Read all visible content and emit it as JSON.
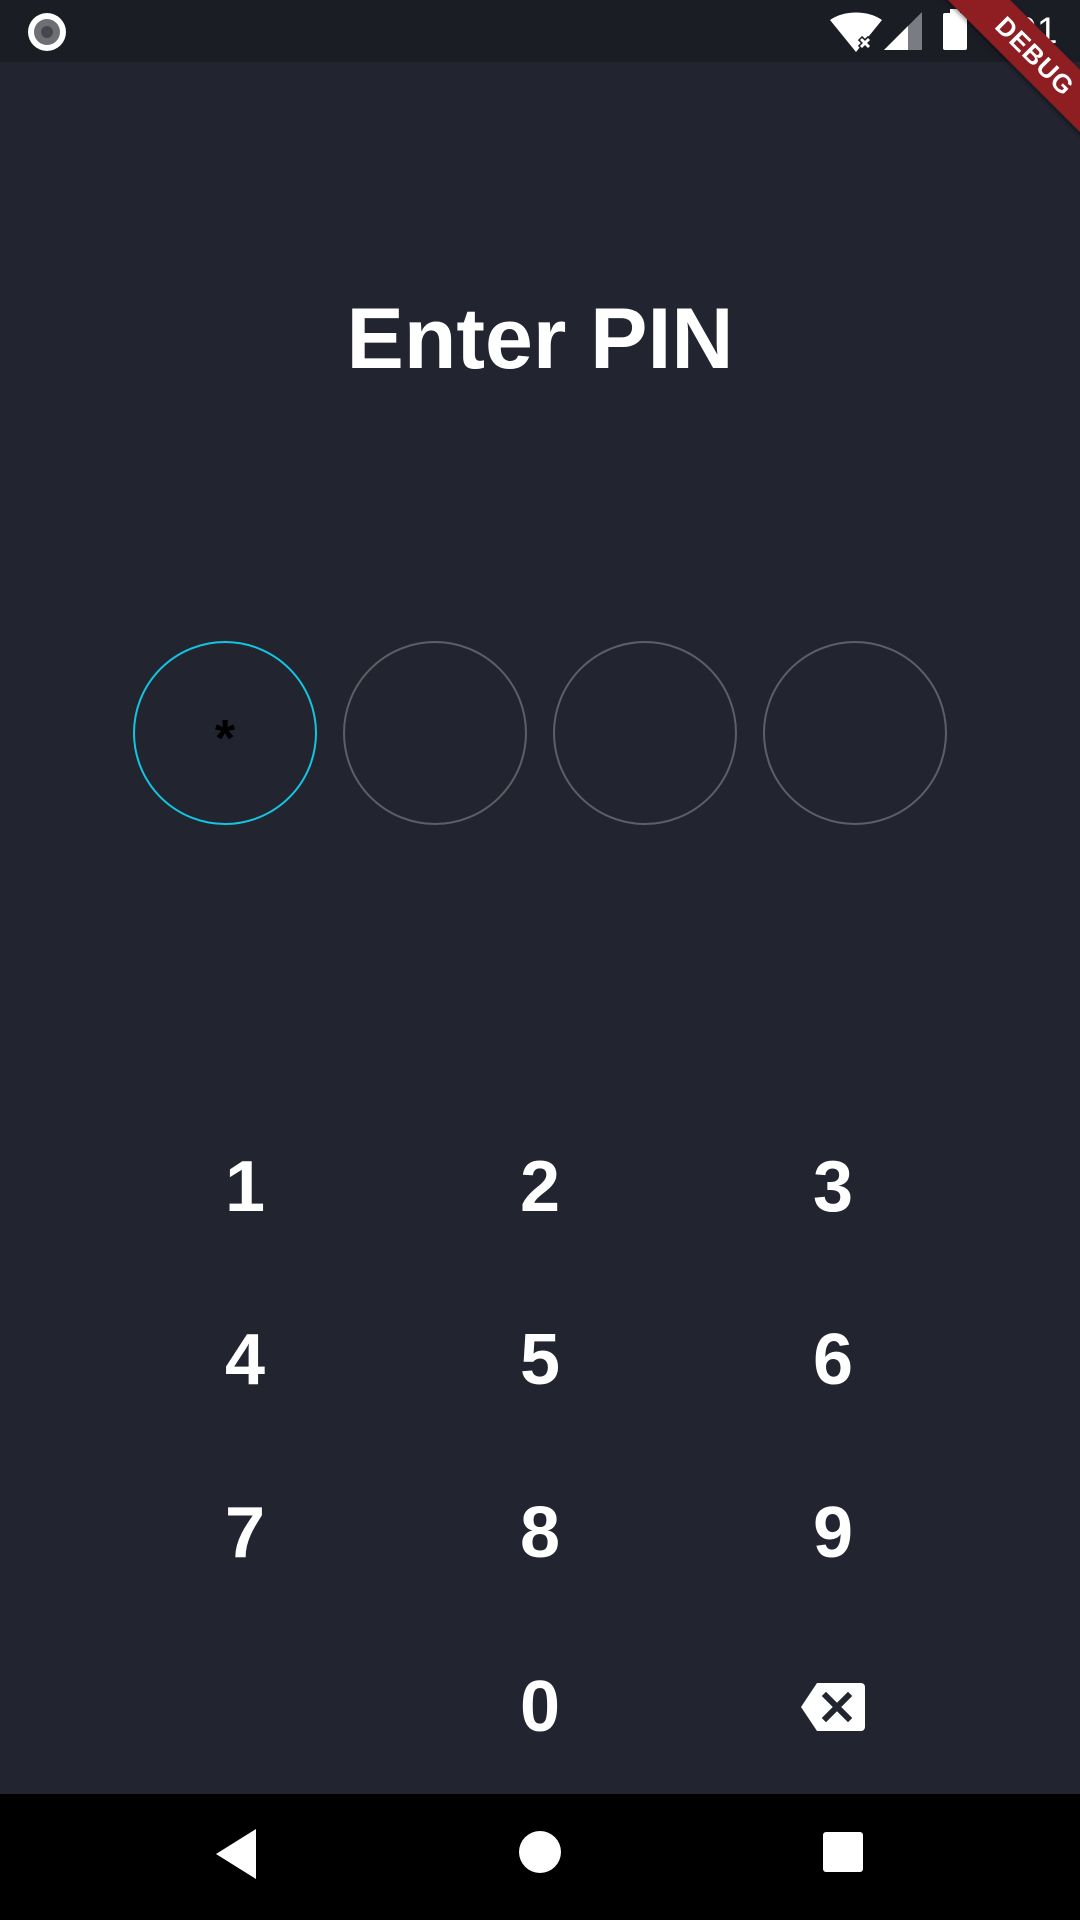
{
  "status_bar": {
    "time": "7:01",
    "icons": [
      "recording-icon",
      "wifi-icon",
      "signal-icon",
      "battery-icon"
    ]
  },
  "debug_banner": {
    "label": "DEBUG"
  },
  "title": "Enter PIN",
  "pin": {
    "length": 4,
    "filled_count": 1,
    "slots": [
      "*",
      "",
      "",
      ""
    ],
    "active_color": "#14c4e0",
    "inactive_color": "#5d5f67"
  },
  "keypad": {
    "keys": [
      "1",
      "2",
      "3",
      "4",
      "5",
      "6",
      "7",
      "8",
      "9",
      "0"
    ],
    "backspace_icon": "backspace-icon"
  },
  "nav_bar": {
    "icons": [
      "back-icon",
      "home-icon",
      "recents-icon"
    ]
  },
  "colors": {
    "background": "#22252f",
    "status_bar": "#1b1d25",
    "accent": "#14c4e0",
    "debug_banner": "#8f1e23"
  }
}
